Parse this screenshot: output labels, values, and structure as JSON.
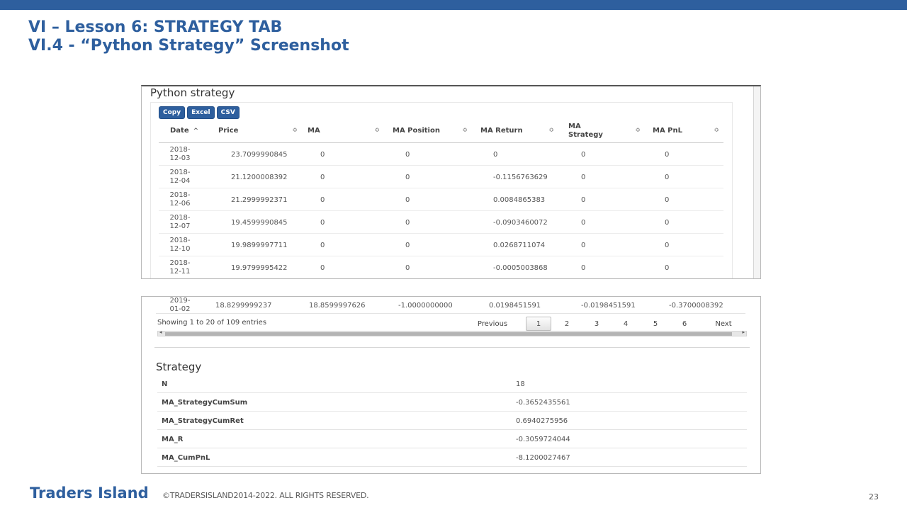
{
  "slide": {
    "title_line1": "VI – Lesson 6: STRATEGY TAB",
    "title_line2": "VI.4 - “Python Strategy” Screenshot",
    "brand": "Traders Island",
    "copyright": "©TRADERSISLAND2014-2022. ALL RIGHTS RESERVED.",
    "page_number": "23"
  },
  "python_strategy": {
    "title": "Python strategy",
    "buttons": [
      "Copy",
      "Excel",
      "CSV"
    ],
    "columns": [
      "Date",
      "Price",
      "MA",
      "MA Position",
      "MA Return",
      "MA\nStrategy",
      "MA PnL"
    ],
    "rows": [
      [
        "2018-\n12-03",
        "23.7099990845",
        "0",
        "0",
        "0",
        "0",
        "0"
      ],
      [
        "2018-\n12-04",
        "21.1200008392",
        "0",
        "0",
        "-0.1156763629",
        "0",
        "0"
      ],
      [
        "2018-\n12-06",
        "21.2999992371",
        "0",
        "0",
        "0.0084865383",
        "0",
        "0"
      ],
      [
        "2018-\n12-07",
        "19.4599990845",
        "0",
        "0",
        "-0.0903460072",
        "0",
        "0"
      ],
      [
        "2018-\n12-10",
        "19.9899997711",
        "0",
        "0",
        "0.0268711074",
        "0",
        "0"
      ],
      [
        "2018-\n12-11",
        "19.9799995422",
        "0",
        "0",
        "-0.0005003868",
        "0",
        "0"
      ]
    ]
  },
  "table_bottom": {
    "last_row": [
      "2019-\n01-02",
      "18.8299999237",
      "18.8599997626",
      "-1.0000000000",
      "0.0198451591",
      "-0.0198451591",
      "-0.3700008392"
    ],
    "info": "Showing 1 to 20 of 109 entries",
    "pager": {
      "previous": "Previous",
      "pages": [
        "1",
        "2",
        "3",
        "4",
        "5",
        "6"
      ],
      "next": "Next"
    }
  },
  "strategy": {
    "title": "Strategy",
    "rows": [
      {
        "key": "N",
        "value": "18"
      },
      {
        "key": "MA_StrategyCumSum",
        "value": "-0.3652435561"
      },
      {
        "key": "MA_StrategyCumRet",
        "value": "0.6940275956"
      },
      {
        "key": "MA_R",
        "value": "-0.3059724044"
      },
      {
        "key": "MA_CumPnL",
        "value": "-8.1200027467"
      }
    ]
  },
  "colors": {
    "accent": "#2e5f9e"
  }
}
